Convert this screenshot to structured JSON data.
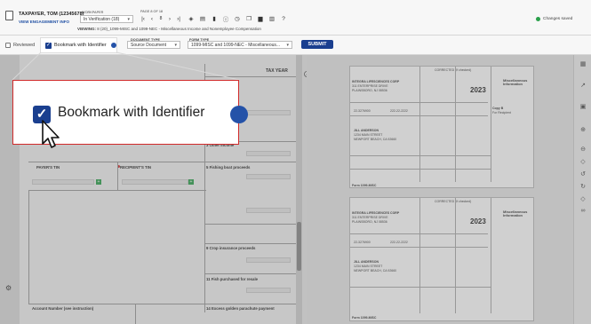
{
  "client": {
    "name": "TAXPAYER, TOM (12345678)",
    "link": "VIEW ENGAGEMENT INFO"
  },
  "workpaper": {
    "label": "WORKPAPER",
    "value": "In Verification (18)"
  },
  "pager": {
    "label": "PAGE 8 OF 18",
    "current": "8"
  },
  "viewing": {
    "label": "VIEWING:",
    "value": "8 (20)_1099-MISC and 1099-NEC - Miscellaneous Income and Nonemployee Compensation"
  },
  "status": {
    "saved": "Changes saved"
  },
  "bar2": {
    "reviewed": "Reviewed",
    "bookmark": "Bookmark with Identifier",
    "doc_type_label": "DOCUMENT TYPE",
    "doc_type_value": "Source Document",
    "form_type_label": "FORM TYPE",
    "form_type_value": "1099-MISC and 1099-NEC - Miscellaneous...",
    "submit": "SUBMIT"
  },
  "callout": {
    "label": "Bookmark with Identifier"
  },
  "form": {
    "tax_year": "TAX YEAR",
    "direct_sales": "3 Other income",
    "payer_tin": "PAYER'S TIN",
    "recipient_tin": "RECIPIENT'S TIN",
    "fishing_boat": "5 Fishing boat proceeds",
    "crop_insurance": "9 Crop insurance proceeds",
    "fish_resale": "11 Fish purchased for resale",
    "account_number": "Account Number (see instruction)",
    "golden_parachute": "14 Excess golden parachute payment"
  },
  "doc": {
    "corrected": "CORRECTED (if checked)",
    "year": "2023",
    "misc_title": "Miscellaneous Information",
    "payer_name": "INTEGRA LIFESCIENCES CORP",
    "payer_addr1": "311 ENTERPRISE DRIVE",
    "payer_addr2": "PLAINSBORO, NJ 08536",
    "payer_tin": "22-3276900",
    "recipient_tin": "222-22-2222",
    "recipient_name": "JILL ANDERSON",
    "recipient_addr1": "1234 MAIN STREET",
    "recipient_addr2": "NEWPORT BEACH, CA 92660",
    "form_no": "Form 1099-MISC",
    "omb": "OMB No. 1545-0115",
    "copy_b": "Copy B",
    "for_recipient": "For Recipient"
  },
  "icons": {
    "doc": "document-icon",
    "first": "first-page-icon",
    "prev": "prev-page-icon",
    "next": "next-page-icon",
    "last": "last-page-icon",
    "layers": "layers-icon",
    "stack": "stack-icon",
    "pdf": "pdf-icon",
    "info": "info-icon",
    "clock": "clock-icon",
    "copy": "copy-icon",
    "comment": "comment-icon",
    "trash": "trash-icon",
    "help": "help-icon",
    "check": "check-circle-icon",
    "settings": "gear-icon"
  },
  "colors": {
    "accent": "#1a3f8f",
    "highlight": "#d12a2a",
    "success": "#2aa04a"
  }
}
